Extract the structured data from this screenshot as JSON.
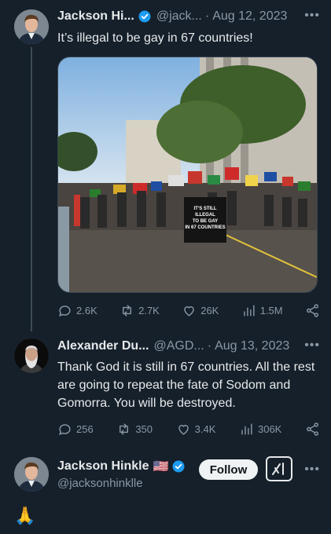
{
  "tweet1": {
    "name": "Jackson Hi...",
    "handle": "@jack...",
    "separator": "·",
    "date": "Aug 12, 2023",
    "text": "It’s illegal to be gay in 67 countries!",
    "media": {
      "sign_lines": [
        "IT'S STILL",
        "ILLEGAL",
        "TO BE GAY",
        "IN 67 COUNTRIES"
      ]
    },
    "actions": {
      "replies": "2.6K",
      "reposts": "2.7K",
      "likes": "26K",
      "views": "1.5M"
    }
  },
  "tweet2": {
    "name": "Alexander Du...",
    "handle": "@AGD...",
    "separator": "·",
    "date": "Aug 13, 2023",
    "text": "Thank God it is still in 67 countries. All the rest are going to repeat the fate of Sodom and Gomorra. You will be destroyed.",
    "actions": {
      "replies": "256",
      "reposts": "350",
      "likes": "3.4K",
      "views": "306K"
    }
  },
  "profile": {
    "name": "Jackson Hinkle",
    "flag": "🇺🇸",
    "handle": "@jacksonhinklle",
    "follow_label": "Follow"
  },
  "reply_emoji": "🙏",
  "icons": [
    "verified-badge-icon",
    "more-icon",
    "reply-icon",
    "repost-icon",
    "like-icon",
    "views-icon",
    "share-icon",
    "grok-icon"
  ],
  "colors": {
    "background": "#15202b",
    "secondary_text": "#8b98a5",
    "verified": "#1d9bf0"
  }
}
